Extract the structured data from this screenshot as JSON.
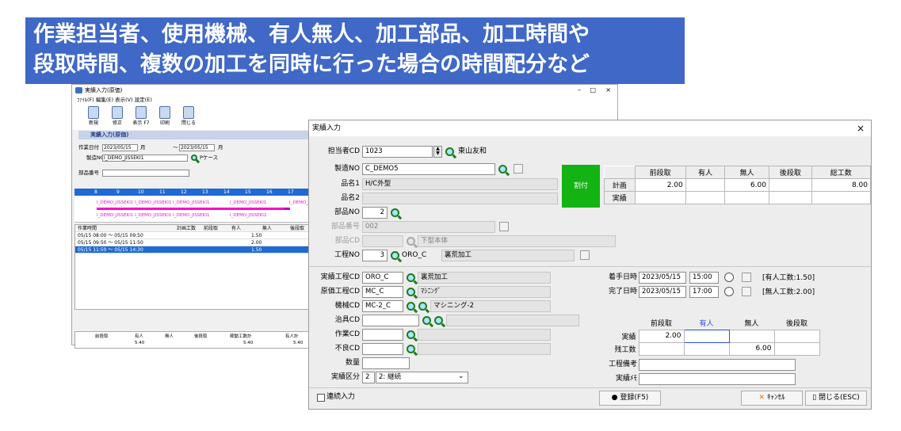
{
  "banner": {
    "line1": "作業担当者、使用機械、有人無人、加工部品、加工時間や",
    "line2": "段取時間、複数の加工を同時に行った場合の時間配分など"
  },
  "back_window": {
    "title": "実績入力(原価)",
    "controls": {
      "min": "–",
      "max": "□",
      "close": "×"
    },
    "menu": "ﾌｧｲﾙ(F)  編集(E)  表示(V)  設定(E)",
    "toolbar": [
      {
        "label": "新規"
      },
      {
        "label": "修正"
      },
      {
        "label": "表示 F7"
      },
      {
        "label": "印刷"
      },
      {
        "label": "閉じる"
      }
    ],
    "header": "実績入力(原価)",
    "work_date_label": "作業日付",
    "date_from": "2023/05/15",
    "date_to": "2023/05/15",
    "month": "月",
    "tilde": "～",
    "mfg_label": "製造NO",
    "mfg_value": "I_DEMO_JISSEKI1",
    "p_case": "Pケース",
    "part_label": "部品番号",
    "hours": [
      "8",
      "9",
      "10",
      "11",
      "12",
      "13",
      "14",
      "15",
      "16",
      "17"
    ],
    "gantt_line1": "I_DEMO_JISSEKI1 I_DEMO_JISSEKI1 I_DEMO_JISSEKI1",
    "gantt_line1b": "I_DEMO_JISSEKI1",
    "gantt_line1c": "I_DEMO_JISS",
    "gantt_line2": "I_DEMO_JISSEKI1 I_DEMO_JISSEKI1  I_DEMO_JISSEKI1",
    "gantt_line2b": "I_DEMO_JISSEKI2",
    "table_headers": [
      "作業時間",
      "計画工数",
      "前段取",
      "有人",
      "無人",
      "後段取"
    ],
    "rows": [
      {
        "time": "05/15 08:00 ～ 05/15 09:50",
        "value": "1.50"
      },
      {
        "time": "05/15 09:50 ～ 05/15 11:50",
        "value": "2.00"
      },
      {
        "time": "05/15 11:50 ～ 05/15 14:30",
        "value": "1.50"
      }
    ],
    "bottom_headers": [
      "前段取",
      "有人",
      "無人",
      "後段取",
      "稼動工数計",
      "有人計"
    ],
    "bottom_values": {
      "yujin": "5.40",
      "total": "5.40",
      "yujin_total": "5.40"
    }
  },
  "dialog": {
    "title": "実績入力",
    "close": "×",
    "tantou_label": "担当者CD",
    "tantou_cd": "1023",
    "tantou_name": "東山友和",
    "seizou_label": "製造NO",
    "seizou_no": "C_DEMO5",
    "hinmei1_label": "品名1",
    "hinmei1": "H/C外型",
    "hinmei2_label": "品名2",
    "buhin_no_label": "部品NO",
    "buhin_no": "2",
    "buhin_bangou_label": "部品番号",
    "buhin_bangou": "002",
    "buhin_cd_label": "部品CD",
    "buhin_cd_name": "下型本体",
    "kouteino_label": "工程NO",
    "koutei_no": "3",
    "koutei_code": "ORO_C",
    "koutei_name": "裏荒加工",
    "split_button": "割付",
    "plan_headers": [
      "前段取",
      "有人",
      "無人",
      "後段取",
      "総工数"
    ],
    "plan_row_label": "計画",
    "plan_values": [
      "2.00",
      "",
      "6.00",
      "",
      "8.00"
    ],
    "actual_row_label": "実績",
    "jisseki_koutei_label": "実績工程CD",
    "jisseki_koutei_cd": "ORO_C",
    "jisseki_koutei_name": "裏荒加工",
    "genka_koutei_label": "原価工程CD",
    "genka_koutei_cd": "MC_C",
    "genka_koutei_name": "ﾏｼﾆﾝｸﾞ",
    "kikai_label": "機械CD",
    "kikai_cd": "MC-2_C",
    "kikai_name": "マシニング-2",
    "jigu_label": "治具CD",
    "sagyou_label": "作業CD",
    "furyou_label": "不良CD",
    "suuryou_label": "数量",
    "kubun_label": "実績区分",
    "kubun_code": "2",
    "kubun_value": "2: 継続",
    "start_label": "着手日時",
    "start_date": "2023/05/15",
    "start_time": "15:00",
    "start_note": "[有人工数:1.50]",
    "end_label": "完了日時",
    "end_date": "2023/05/15",
    "end_time": "17:00",
    "end_note": "[無人工数:2.00]",
    "result_headers": [
      "前段取",
      "有人",
      "無人",
      "後段取"
    ],
    "result_row_label": "実績",
    "result_values": [
      "2.00",
      "",
      "",
      ""
    ],
    "remain_label": "残工数",
    "remain_values": [
      "",
      "",
      "6.00",
      ""
    ],
    "koutei_bikou_label": "工程備考",
    "jisseki_memo_label": "実績ﾒﾓ",
    "continuous_label": "連続入力",
    "register_button": "登録(F5)",
    "cancel_button": "ｷｬﾝｾﾙ",
    "close_button": "閉じる(ESC)",
    "colors": {
      "yujin_header": "#2a4fd6",
      "green": "#12b312"
    }
  }
}
